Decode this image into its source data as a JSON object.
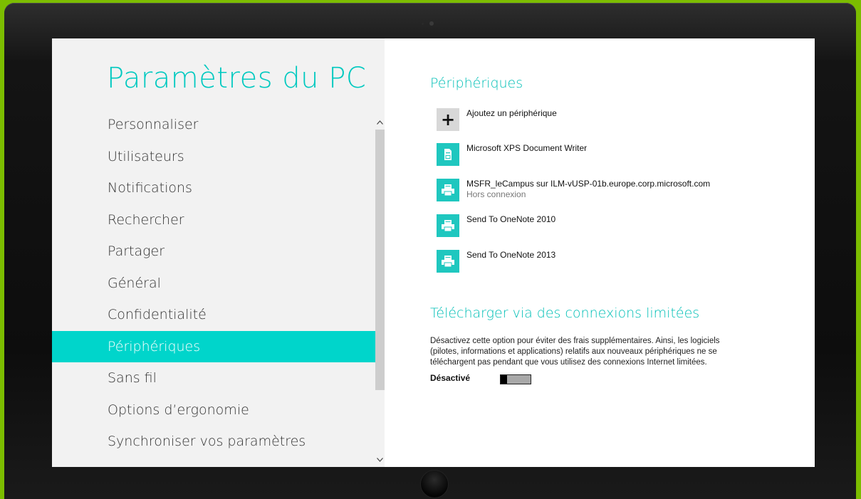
{
  "app": {
    "title": "Paramètres du PC",
    "accent_color": "#00d5cb"
  },
  "nav": {
    "items": [
      {
        "label": "Personnaliser"
      },
      {
        "label": "Utilisateurs"
      },
      {
        "label": "Notifications"
      },
      {
        "label": "Rechercher"
      },
      {
        "label": "Partager"
      },
      {
        "label": "Général"
      },
      {
        "label": "Confidentialité"
      },
      {
        "label": "Périphériques",
        "selected": true
      },
      {
        "label": "Sans fil"
      },
      {
        "label": "Options d’ergonomie"
      },
      {
        "label": "Synchroniser vos paramètres"
      }
    ],
    "scroll_up_icon": "chevron-up-icon",
    "scroll_down_icon": "chevron-down-icon"
  },
  "devices": {
    "heading": "Périphériques",
    "items": [
      {
        "name": "Ajoutez un périphérique",
        "status": "",
        "icon": "add-icon"
      },
      {
        "name": "Microsoft XPS Document Writer",
        "status": "",
        "icon": "document-printer-icon"
      },
      {
        "name": "MSFR_leCampus sur ILM-vUSP-01b.europe.corp.microsoft.com",
        "status": "Hors connexion",
        "icon": "printer-icon"
      },
      {
        "name": "Send To OneNote 2010",
        "status": "",
        "icon": "printer-icon"
      },
      {
        "name": "Send To OneNote 2013",
        "status": "",
        "icon": "printer-icon"
      }
    ]
  },
  "metered": {
    "heading": "Télécharger via des connexions limitées",
    "description": "Désactivez cette option pour éviter des frais supplémentaires. Ainsi, les logiciels (pilotes, informations et applications) relatifs aux nouveaux périphériques ne se téléchargent pas pendant que vous utilisez des connexions Internet limitées.",
    "toggle_label": "Désactivé",
    "toggle_on": false
  }
}
